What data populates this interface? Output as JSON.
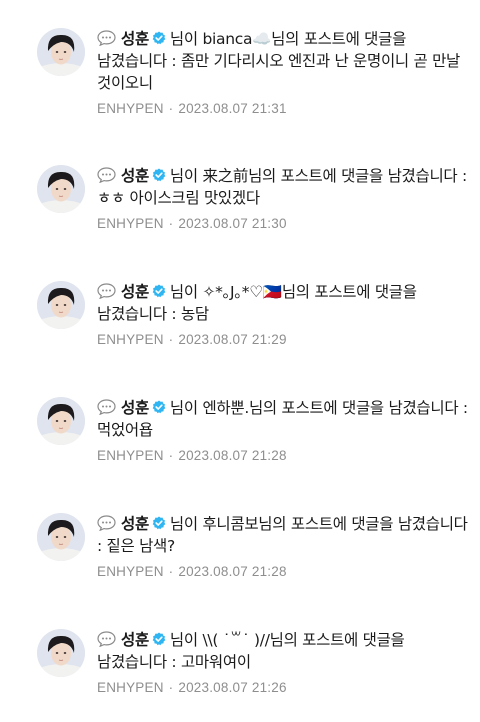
{
  "feed": {
    "items": [
      {
        "author": "성훈",
        "text": "님이 bianca☁️님의 포스트에 댓글을 남겼습니다 : 좀만 기다리시오 엔진과 난 운명이니 곧 만날 것이오니",
        "source": "ENHYPEN",
        "separator": "·",
        "timestamp": "2023.08.07 21:31"
      },
      {
        "author": "성훈",
        "text": "님이 来之前님의 포스트에 댓글을 남겼습니다 : ㅎㅎ 아이스크림 맛있겠다",
        "source": "ENHYPEN",
        "separator": "·",
        "timestamp": "2023.08.07 21:30"
      },
      {
        "author": "성훈",
        "text": "님이 ✧*｡J｡*♡🇵🇭님의 포스트에 댓글을 남겼습니다 : 농담",
        "source": "ENHYPEN",
        "separator": "·",
        "timestamp": "2023.08.07 21:29"
      },
      {
        "author": "성훈",
        "text": "님이 엔하뿐.님의 포스트에 댓글을 남겼습니다 : 먹었어욥",
        "source": "ENHYPEN",
        "separator": "·",
        "timestamp": "2023.08.07 21:28"
      },
      {
        "author": "성훈",
        "text": "님이 후니콤보님의 포스트에 댓글을 남겼습니다 : 짙은 남색?",
        "source": "ENHYPEN",
        "separator": "·",
        "timestamp": "2023.08.07 21:28"
      },
      {
        "author": "성훈",
        "text": "님이 \\\\( ˙꒳˙ )//님의 포스트에 댓글을 남겼습니다 : 고마워여이",
        "source": "ENHYPEN",
        "separator": "·",
        "timestamp": "2023.08.07 21:26"
      }
    ]
  },
  "icons": {
    "bubble": "speech-bubble-icon",
    "verified": "verified-badge-icon",
    "avatar": "profile-avatar"
  },
  "colors": {
    "verified": "#2fb6f2",
    "meta": "#8e8e8e",
    "text": "#1b1b1b"
  }
}
